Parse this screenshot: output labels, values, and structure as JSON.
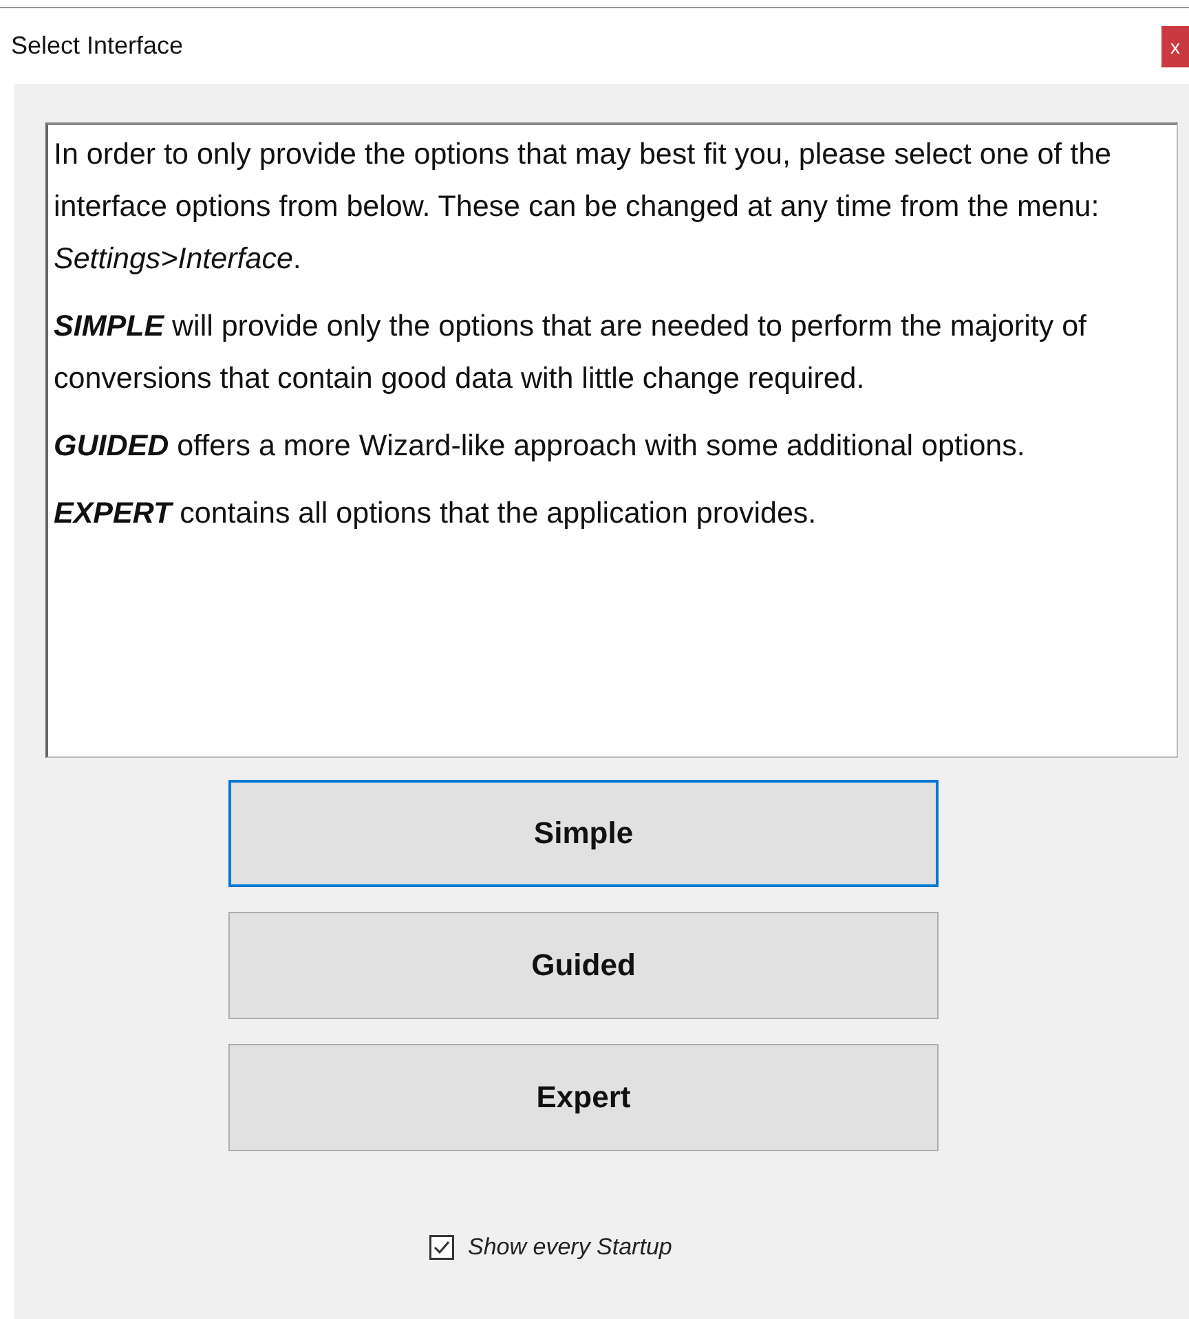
{
  "window": {
    "title": "Select Interface",
    "close": "x"
  },
  "info": [
    {
      "kind": "intro",
      "text": "In order to only provide the options that may best fit you, please select one of the interface options from below. These can be changed at any time from the menu: *Settings>Interface*."
    },
    {
      "kind": "option",
      "term": "SIMPLE",
      "text": "will provide only the options that are needed to perform the majority of conversions that contain good data with little change required."
    },
    {
      "kind": "option",
      "term": "GUIDED",
      "text": "offers a more Wizard-like approach with some additional options."
    },
    {
      "kind": "option",
      "term": "EXPERT",
      "text": "contains all options that the application provides."
    }
  ],
  "buttons": [
    {
      "label": "Simple",
      "selected": true
    },
    {
      "label": "Guided",
      "selected": false
    },
    {
      "label": "Expert",
      "selected": false
    }
  ],
  "startup": {
    "label": "Show every Startup",
    "checked": true
  }
}
